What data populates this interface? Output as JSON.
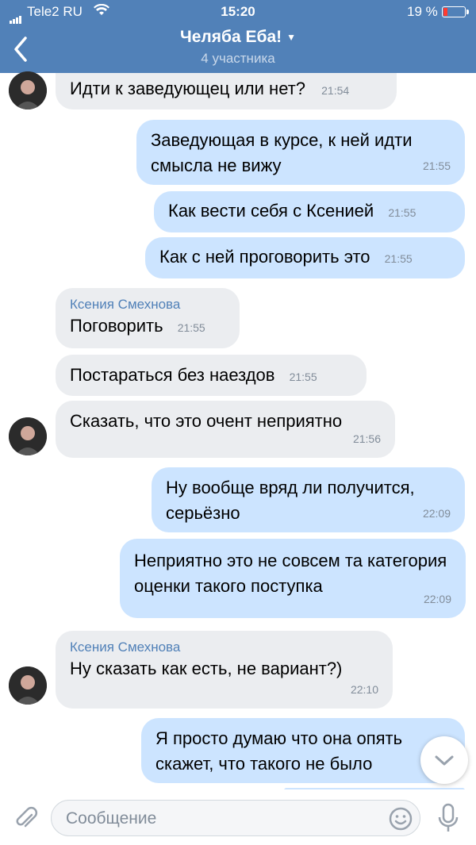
{
  "status_bar": {
    "carrier": "Tele2 RU",
    "time": "15:20",
    "battery": "19 %"
  },
  "header": {
    "title": "Челяба Еба!",
    "subtitle": "4 участника"
  },
  "messages": [
    {
      "text": "Идти к заведующец или нет?",
      "time": "21:54"
    },
    {
      "text": "Заведующая в курсе, к ней идти смысла не вижу",
      "time": "21:55"
    },
    {
      "text": "Как вести себя с Ксенией",
      "time": "21:55"
    },
    {
      "text": "Как с ней проговорить это",
      "time": "21:55"
    },
    {
      "sender": "Ксения Смехнова",
      "text": "Поговорить",
      "time": "21:55"
    },
    {
      "text": "Постараться без наездов",
      "time": "21:55"
    },
    {
      "text": "Сказать, что это очент неприятно",
      "time": "21:56"
    },
    {
      "text": "Ну вообще вряд ли получится, серьёзно",
      "time": "22:09"
    },
    {
      "text": "Неприятно это не совсем та категория оценки такого поступка",
      "time": "22:09"
    },
    {
      "sender": "Ксения Смехнова",
      "text": "Ну сказать как есть, не вариант?)",
      "time": "22:10"
    },
    {
      "text": "Я просто думаю что она опять скажет, что такого не было"
    }
  ],
  "input": {
    "placeholder": "Сообщение"
  },
  "colors": {
    "header": "#5181b8",
    "incoming": "#ebedf0",
    "outgoing": "#cce4ff",
    "accent": "#5181b8"
  },
  "icons": [
    "back-arrow-icon",
    "chevron-down-icon",
    "attach-icon",
    "emoji-icon",
    "mic-icon",
    "scroll-down-icon",
    "wifi-icon",
    "battery-icon"
  ]
}
